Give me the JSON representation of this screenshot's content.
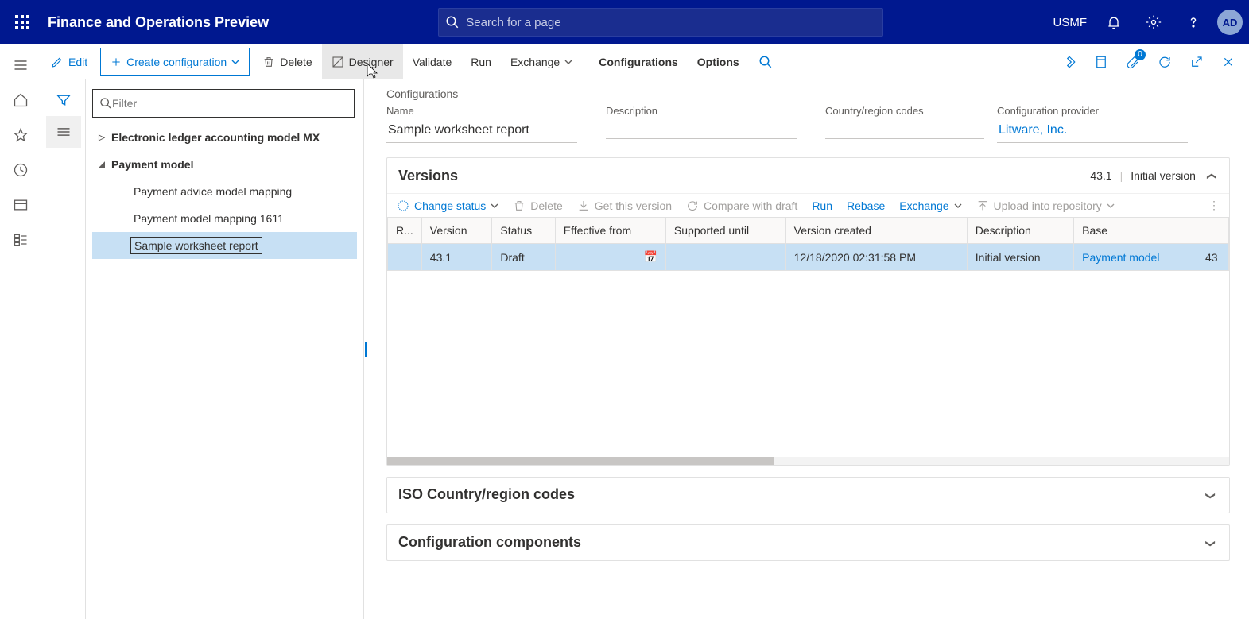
{
  "shell": {
    "title": "Finance and Operations Preview",
    "searchPlaceholder": "Search for a page",
    "company": "USMF",
    "avatar": "AD"
  },
  "actionbar": {
    "edit": "Edit",
    "createConfig": "Create configuration",
    "delete": "Delete",
    "designer": "Designer",
    "validate": "Validate",
    "run": "Run",
    "exchange": "Exchange",
    "configurations": "Configurations",
    "options": "Options",
    "attachBadge": "0"
  },
  "tree": {
    "filterPlaceholder": "Filter",
    "nodes": [
      {
        "label": "Electronic ledger accounting model MX",
        "depth": 0,
        "expanded": false
      },
      {
        "label": "Payment model",
        "depth": 0,
        "expanded": true
      },
      {
        "label": "Payment advice model mapping",
        "depth": 2
      },
      {
        "label": "Payment model mapping 1611",
        "depth": 2
      },
      {
        "label": "Sample worksheet report",
        "depth": 2,
        "selected": true
      }
    ]
  },
  "details": {
    "breadcrumb": "Configurations",
    "nameLabel": "Name",
    "nameValue": "Sample worksheet report",
    "descriptionLabel": "Description",
    "descriptionValue": "",
    "countryLabel": "Country/region codes",
    "countryValue": "",
    "providerLabel": "Configuration provider",
    "providerValue": "Litware, Inc."
  },
  "versions": {
    "title": "Versions",
    "summaryVersion": "43.1",
    "summaryDesc": "Initial version",
    "toolbar": {
      "changeStatus": "Change status",
      "delete": "Delete",
      "getThisVersion": "Get this version",
      "compare": "Compare with draft",
      "run": "Run",
      "rebase": "Rebase",
      "exchange": "Exchange",
      "upload": "Upload into repository"
    },
    "columns": {
      "rowselect": "R...",
      "version": "Version",
      "status": "Status",
      "effectiveFrom": "Effective from",
      "supportedUntil": "Supported until",
      "versionCreated": "Version created",
      "description": "Description",
      "base": "Base"
    },
    "rows": [
      {
        "version": "43.1",
        "status": "Draft",
        "effectiveFrom": "",
        "supportedUntil": "",
        "versionCreated": "12/18/2020 02:31:58 PM",
        "description": "Initial version",
        "baseName": "Payment model",
        "baseVer": "43"
      }
    ]
  },
  "sections": {
    "iso": "ISO Country/region codes",
    "components": "Configuration components"
  }
}
